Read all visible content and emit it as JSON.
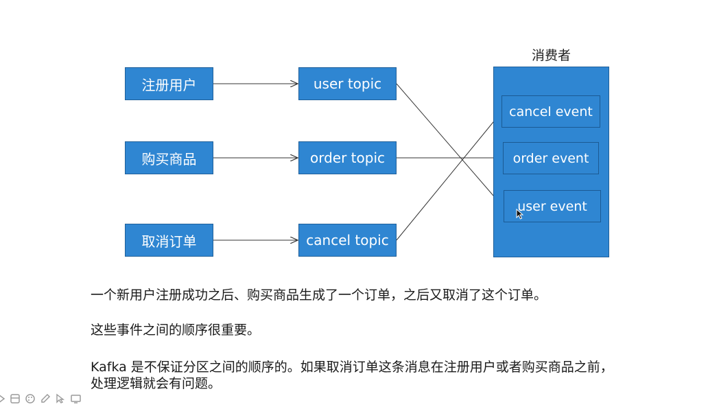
{
  "diagram": {
    "consumer_label": "消费者",
    "sources": [
      {
        "label": "注册用户"
      },
      {
        "label": "购买商品"
      },
      {
        "label": "取消订单"
      }
    ],
    "topics": [
      {
        "label": "user topic"
      },
      {
        "label": "order topic"
      },
      {
        "label": "cancel topic"
      }
    ],
    "events": [
      {
        "label": "cancel event"
      },
      {
        "label": "order event"
      },
      {
        "label": "user event"
      }
    ],
    "colors": {
      "box_fill": "#2f86d2",
      "box_border": "#1f5f99",
      "arrow": "#333333"
    }
  },
  "text": {
    "line1": "一个新用户注册成功之后、购买商品生成了一个订单，之后又取消了这个订单。",
    "line2": "这些事件之间的顺序很重要。",
    "line3": "Kafka 是不保证分区之间的顺序的。如果取消订单这条消息在注册用户或者购买商品之前，",
    "line4": "处理逻辑就会有问题。"
  },
  "toolbar": {
    "icons": [
      "arrow-icon",
      "window-icon",
      "palette-icon",
      "pen-icon",
      "pointer-icon",
      "screen-icon"
    ]
  }
}
